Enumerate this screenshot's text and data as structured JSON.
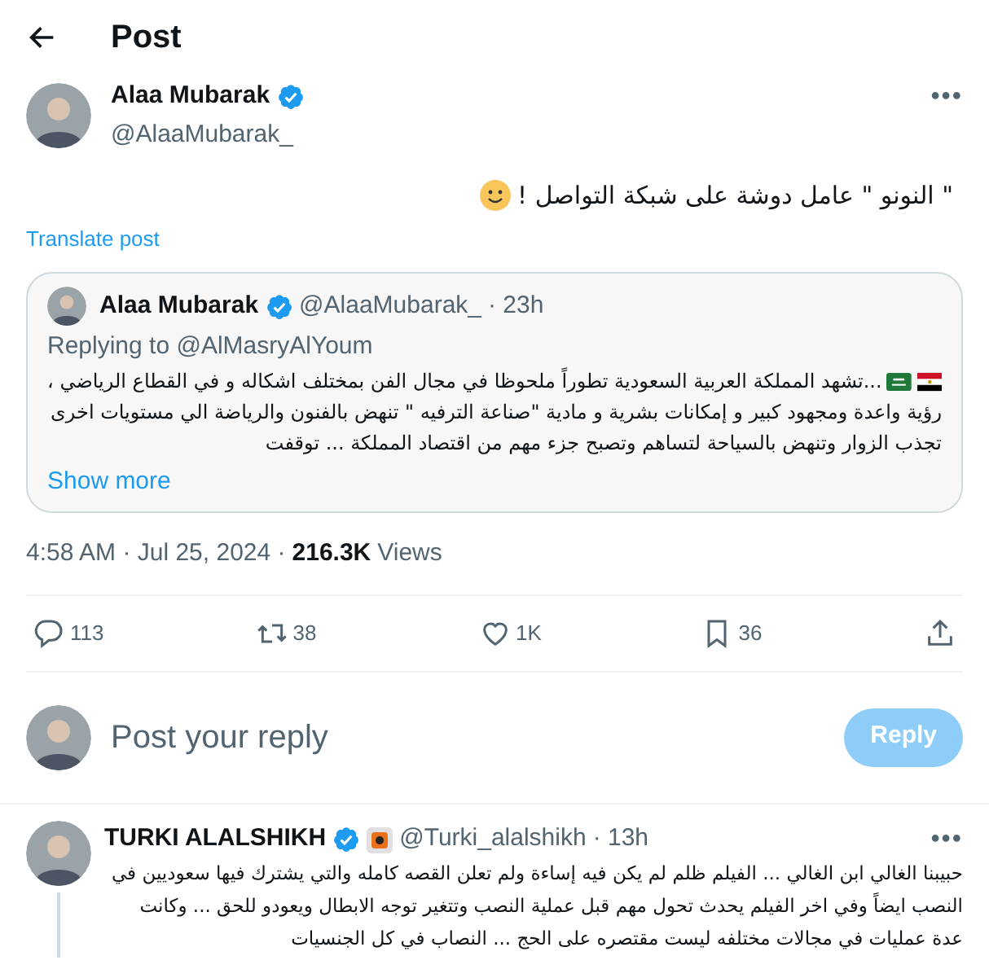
{
  "header": {
    "title": "Post"
  },
  "post": {
    "author": "Alaa Mubarak",
    "verified": true,
    "handle": "@AlaaMubarak_",
    "more": "•••",
    "text": "\" النونو \" عامل دوشة على شبكة التواصل !",
    "translate": "Translate post",
    "quote": {
      "author": "Alaa Mubarak",
      "verified": true,
      "handle": "@AlaaMubarak_",
      "time": "· 23h",
      "replying": "Replying to @AlMasryAlYoum",
      "lines": [
        "...تشهد المملكة العربية السعودية تطوراً ملحوظا في مجال الفن بمختلف اشكاله و في  القطاع الرياضي ،",
        "رؤية واعدة ومجهود كبير و إمكانات بشرية و مادية  \"صناعة الترفيه \" تنهض بالفنون والرياضة الي مستويات اخرى",
        "تجذب الزوار وتنهض بالسياحة لتساهم وتصبح جزء مهم من اقتصاد المملكة ... توقفت"
      ],
      "show_more": "Show more"
    },
    "time": "4:58 AM · Jul 25, 2024 ·",
    "views_count": "216.3K",
    "views_label": "Views",
    "actions": [
      {
        "kind": "reply",
        "count": "113"
      },
      {
        "kind": "repost",
        "count": "38"
      },
      {
        "kind": "like",
        "count": "1K"
      },
      {
        "kind": "bookmark",
        "count": "36"
      },
      {
        "kind": "share"
      }
    ]
  },
  "composer": {
    "placeholder": "Post your reply",
    "button": "Reply",
    "disabled": true
  },
  "reply": {
    "author": "TURKI ALALSHIKH",
    "verified": true,
    "handle": "@Turki_alalshikh",
    "time": "· 13h",
    "more": "•••",
    "lines": [
      "حبيبنا الغالي ابن الغالي ... الفيلم ظلم لم يكن فيه إساءة ولم تعلن القصه كامله والتي يشترك فيها سعوديين في",
      "النصب ايضاً وفي اخر الفيلم يحدث تحول مهم قبل عملية النصب وتتغير توجه الابطال ويعودو للحق ... وكانت",
      "عدة عمليات في مجالات مختلفه ليست مقتصره على الحج ... النصاب في كل الجنسيات"
    ]
  }
}
